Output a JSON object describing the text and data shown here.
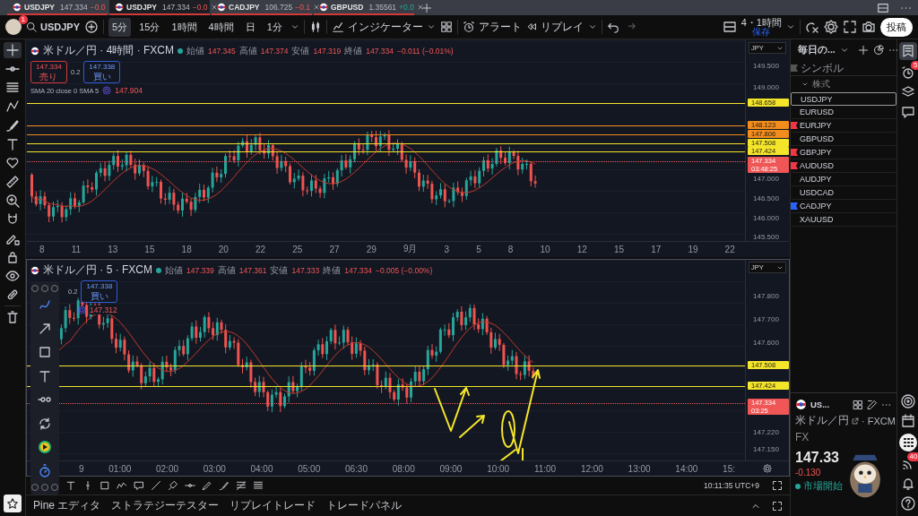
{
  "tabs": [
    {
      "symbol": "USDJPY",
      "rising": false,
      "price": "147.334",
      "change": "−0.0",
      "selected": false
    },
    {
      "symbol": "USDJPY",
      "rising": false,
      "price": "147.334",
      "change": "−0.0",
      "selected": true
    },
    {
      "symbol": "CADJPY",
      "rising": false,
      "price": "106.725",
      "change": "−0.1",
      "selected": false
    },
    {
      "symbol": "GBPUSD",
      "rising": true,
      "price": "1.35561",
      "change": "+0.0",
      "selected": false
    }
  ],
  "toolbar": {
    "avatar_badge": "1",
    "search": "USDJPY",
    "intervals": [
      {
        "label": "5分",
        "selected": true
      },
      {
        "label": "15分",
        "selected": false
      },
      {
        "label": "1時間",
        "selected": false
      },
      {
        "label": "4時間",
        "selected": false
      },
      {
        "label": "日",
        "selected": false
      },
      {
        "label": "1分",
        "selected": false
      }
    ],
    "indicators": "インジケーター",
    "alert": "アラート",
    "replay": "リプレイ",
    "layout": "4・1時間",
    "layout_status": "保存",
    "publish": "投稿"
  },
  "charts": [
    {
      "selected": false,
      "title": "米ドル／円 · 4時間 · FXCM",
      "ohlc": [
        {
          "label": "始値",
          "value": "147.345"
        },
        {
          "label": "高値",
          "value": "147.374"
        },
        {
          "label": "安値",
          "value": "147.319"
        },
        {
          "label": "終値",
          "value": "147.334"
        }
      ],
      "change": "−0.011 (−0.01%)",
      "sell": {
        "price": "147.334",
        "label": "売り"
      },
      "spread": "0.2",
      "buy": {
        "price": "147.338",
        "label": "買い"
      },
      "indicator_label": "SMA 20 close 0 SMA 5",
      "indicator_value": "147.904",
      "currency": "JPY",
      "price_ticks": [
        "149.500",
        "149.000",
        "147.000",
        "146.500",
        "146.000",
        "145.500"
      ],
      "price_markers": [
        {
          "price": "148.658",
          "color": "#f5e52a"
        },
        {
          "price": "148.123",
          "color": "#f28c1c"
        },
        {
          "price": "147.806",
          "color": "#f28c1c"
        },
        {
          "price": "147.508",
          "color": "#f5e52a"
        },
        {
          "price": "147.424",
          "color": "#f5e52a"
        },
        {
          "price": "147.334",
          "time": "03:48:25",
          "color": "#f05656"
        }
      ],
      "time_ticks": [
        "8",
        "11",
        "13",
        "15",
        "18",
        "20",
        "22",
        "25",
        "27",
        "29",
        "9月",
        "3",
        "5",
        "8",
        "10",
        "12",
        "15",
        "17",
        "19",
        "22"
      ]
    },
    {
      "selected": true,
      "title": "米ドル／円 · 5 · FXCM",
      "ohlc": [
        {
          "label": "始値",
          "value": "147.339"
        },
        {
          "label": "高値",
          "value": "147.361"
        },
        {
          "label": "安値",
          "value": "147.333"
        },
        {
          "label": "終値",
          "value": "147.334"
        }
      ],
      "change": "−0.005 (−0.00%)",
      "spread": "0.2",
      "buy": {
        "price": "147.338",
        "label": "買い"
      },
      "indicator_value": "147.312",
      "currency": "JPY",
      "price_ticks": [
        "147.800",
        "147.700",
        "147.600",
        "147.220",
        "147.150"
      ],
      "price_markers": [
        {
          "price": "147.508",
          "color": "#f5e52a"
        },
        {
          "price": "147.424",
          "color": "#f5e52a"
        },
        {
          "price": "147.334",
          "time": "03:25",
          "color": "#f05656"
        }
      ],
      "time_ticks": [
        "9",
        "01:00",
        "02:00",
        "03:00",
        "04:00",
        "05:00",
        "06:30",
        "08:00",
        "09:00",
        "10:00",
        "11:00",
        "12:00",
        "13:00",
        "14:00",
        "15:"
      ]
    }
  ],
  "clock": "10:11:35 UTC+9",
  "bottom_tabs": [
    "Pine エディタ",
    "ストラテジーテスター",
    "リプレイトレード",
    "トレードパネル"
  ],
  "watchlist": {
    "title": "毎日の...",
    "column": "シンボル",
    "group": {
      "name": "株式",
      "expanded": true
    },
    "items": [
      {
        "symbol": "USDJPY",
        "selected": true
      },
      {
        "symbol": "EURUSD",
        "selected": false
      },
      {
        "symbol": "EURJPY",
        "selected": false,
        "color": "#f23645"
      },
      {
        "symbol": "GBPUSD",
        "selected": false
      },
      {
        "symbol": "GBPJPY",
        "selected": false,
        "color": "#f23645"
      },
      {
        "symbol": "AUDUSD",
        "selected": false,
        "color": "#f23645"
      },
      {
        "symbol": "AUDJPY",
        "selected": false
      },
      {
        "symbol": "USDCAD",
        "selected": false
      },
      {
        "symbol": "CADJPY",
        "selected": false,
        "color": "#2962ff"
      },
      {
        "symbol": "XAUUSD",
        "selected": false
      }
    ]
  },
  "detail": {
    "symbol": "US...",
    "name": "米ドル／円",
    "exchange": "· FXCM",
    "type": "FX",
    "price": "147.33",
    "change": "-0.130",
    "status": "市場開始"
  },
  "sidebar_badges": {
    "alerts": "5",
    "feed": "40"
  }
}
